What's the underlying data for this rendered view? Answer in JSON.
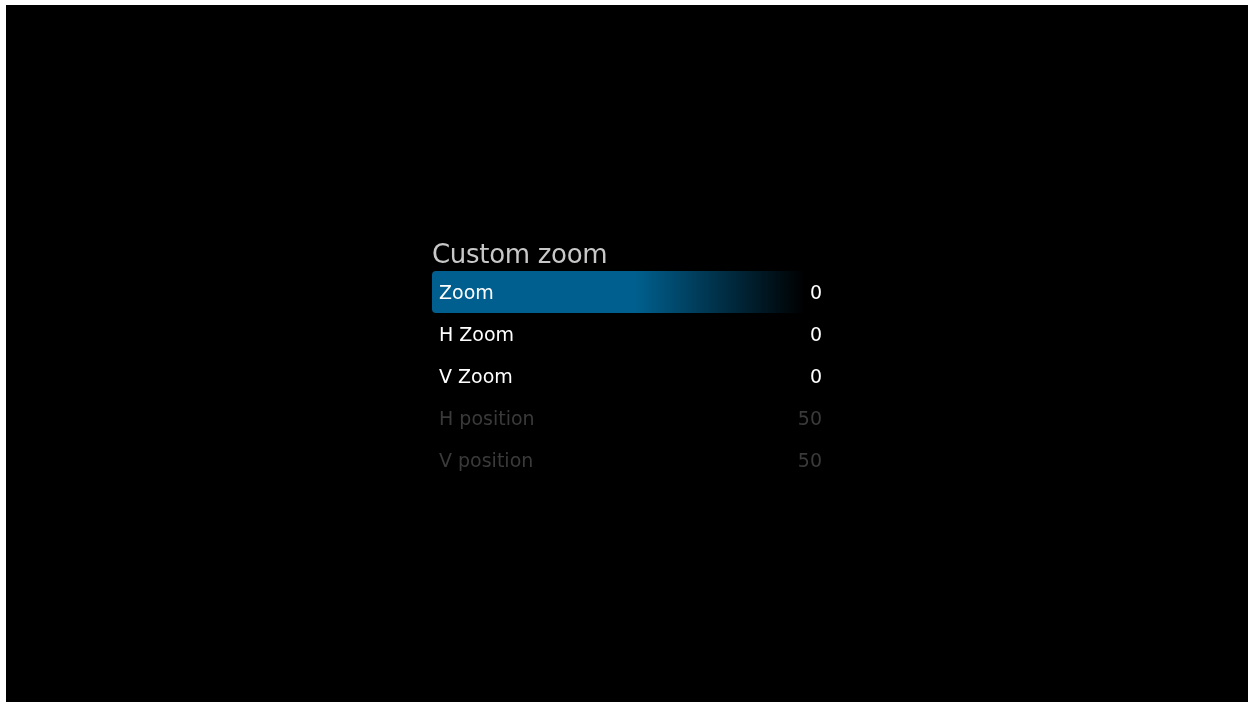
{
  "menu": {
    "title": "Custom zoom",
    "items": [
      {
        "label": "Zoom",
        "value": "0",
        "selected": true,
        "disabled": false
      },
      {
        "label": "H Zoom",
        "value": "0",
        "selected": false,
        "disabled": false
      },
      {
        "label": "V Zoom",
        "value": "0",
        "selected": false,
        "disabled": false
      },
      {
        "label": "H position",
        "value": "50",
        "selected": false,
        "disabled": true
      },
      {
        "label": "V position",
        "value": "50",
        "selected": false,
        "disabled": true
      }
    ]
  }
}
